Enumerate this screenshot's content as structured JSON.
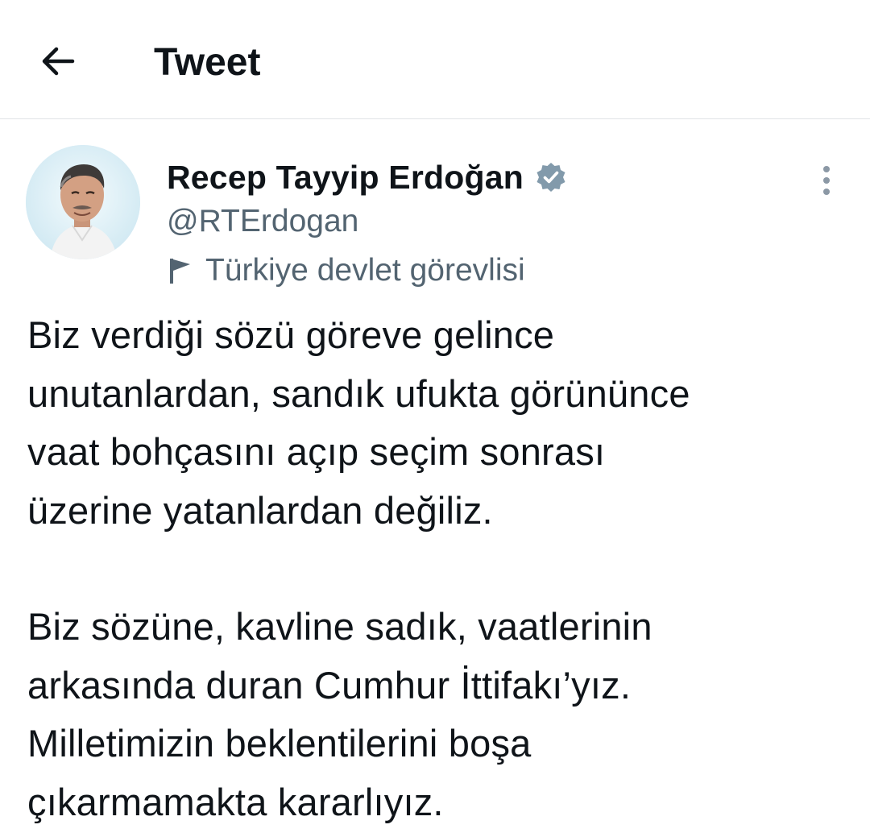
{
  "header": {
    "back_icon": "arrow-left-icon",
    "title": "Tweet"
  },
  "author": {
    "display_name": "Recep Tayyip Erdoğan",
    "verified_icon": "verified-badge-icon",
    "handle": "@RTErdogan",
    "affiliation_icon": "flag-icon",
    "affiliation": "Türkiye devlet görevlisi"
  },
  "actions": {
    "more_icon": "more-vertical-icon"
  },
  "tweet": {
    "paragraphs": [
      "Biz verdiği sözü göreve gelince\nunutanlardan, sandık ufukta görününce\nvaat bohçasını açıp seçim sonrası\nüzerine yatanlardan değiliz.",
      "Biz sözüne, kavline sadık, vaatlerinin\narkasında duran Cumhur İttifakı’yız.\nMilletimizin beklentilerini boşa\nçıkarmamakta kararlıyız."
    ]
  },
  "colors": {
    "text_primary": "#0f1419",
    "text_secondary": "#536471",
    "verified_badge": "#829aab",
    "divider": "#e1e4e6"
  }
}
